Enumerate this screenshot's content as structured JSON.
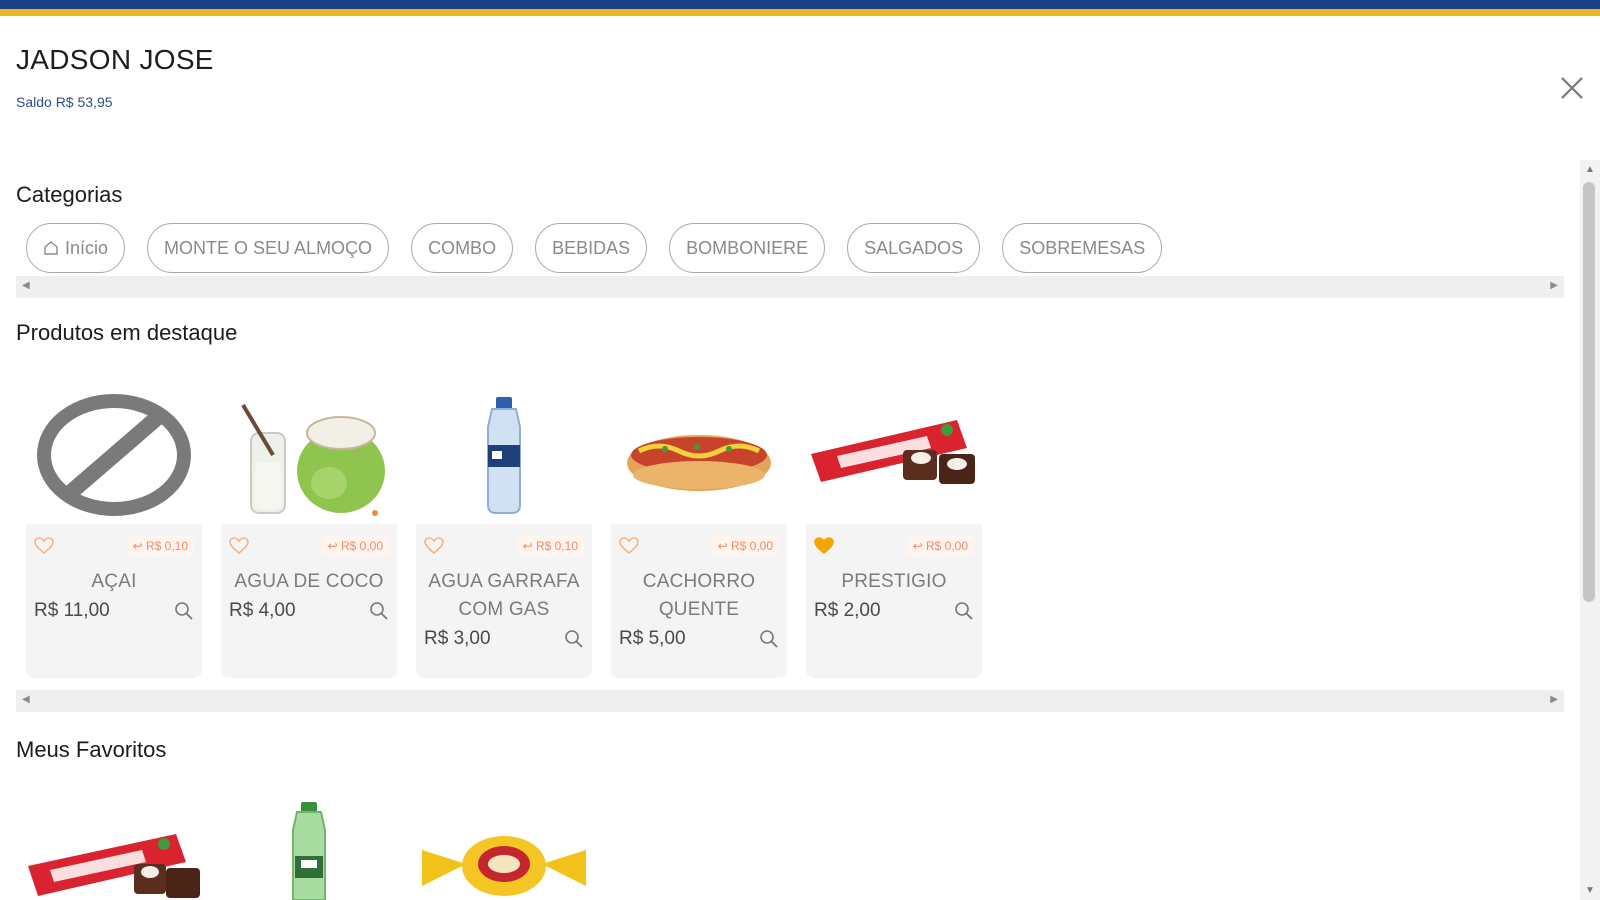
{
  "header": {
    "user_name": "JADSON JOSE",
    "balance": "Saldo R$ 53,95"
  },
  "categories": {
    "title": "Categorias",
    "items": [
      {
        "label": "Início",
        "icon": "home-icon"
      },
      {
        "label": "MONTE O SEU ALMOÇO"
      },
      {
        "label": "COMBO"
      },
      {
        "label": "BEBIDAS"
      },
      {
        "label": "BOMBONIERE"
      },
      {
        "label": "SALGADOS"
      },
      {
        "label": "SOBREMESAS"
      }
    ]
  },
  "featured": {
    "title": "Produtos em destaque",
    "products": [
      {
        "name": "AÇAI",
        "price": "R$ 11,00",
        "cashback": "↩ R$ 0,10",
        "favorite": false,
        "image": "no-image-icon"
      },
      {
        "name": "AGUA DE COCO",
        "price": "R$ 4,00",
        "cashback": "↩ R$ 0,00",
        "favorite": false,
        "image": "coconut-water-image"
      },
      {
        "name": "AGUA GARRAFA COM GAS",
        "price": "R$ 3,00",
        "cashback": "↩ R$ 0,10",
        "favorite": false,
        "image": "water-bottle-image"
      },
      {
        "name": "CACHORRO QUENTE",
        "price": "R$ 5,00",
        "cashback": "↩ R$ 0,00",
        "favorite": false,
        "image": "hot-dog-image"
      },
      {
        "name": "PRESTIGIO",
        "price": "R$ 2,00",
        "cashback": "↩ R$ 0,00",
        "favorite": true,
        "image": "chocolate-bar-image"
      }
    ]
  },
  "favorites": {
    "title": "Meus Favoritos",
    "items": [
      {
        "image": "chocolate-bar-image"
      },
      {
        "image": "green-bottle-image"
      },
      {
        "image": "bonbon-image"
      }
    ]
  },
  "colors": {
    "brand_blue": "#1b3f86",
    "brand_yellow": "#e8b81c",
    "favorite_active": "#f2a600",
    "favorite_inactive": "#f0b48a",
    "cashback_text": "#f08a6a"
  }
}
